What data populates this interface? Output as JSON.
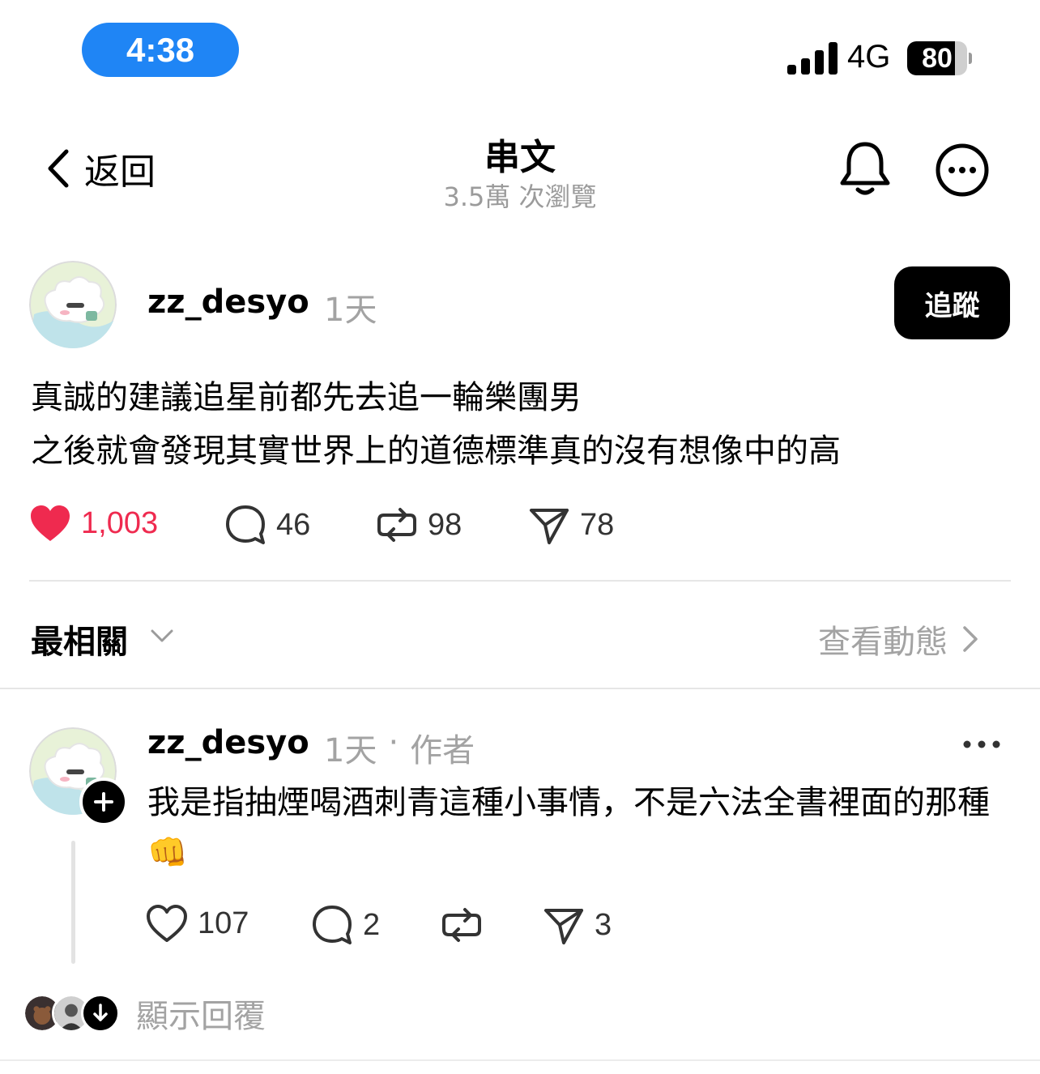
{
  "status_bar": {
    "time": "4:38",
    "network": "4G",
    "battery": "80",
    "battery_fraction": 0.8
  },
  "header": {
    "back_label": "返回",
    "title": "串文",
    "views": "3.5萬 次瀏覽"
  },
  "post": {
    "username": "zz_desyo",
    "time": "1天",
    "follow_label": "追蹤",
    "lines": [
      "真誠的建議追星前都先去追一輪樂團男",
      "之後就會發現其實世界上的道德標準真的沒有想像中的高"
    ],
    "likes": "1,003",
    "comments": "46",
    "reposts": "98",
    "shares": "78",
    "like_color": "#ef2a4f"
  },
  "sort": {
    "label": "最相關",
    "activity_label": "查看動態"
  },
  "reply": {
    "username": "zz_desyo",
    "time": "1天",
    "separator": "·",
    "role": "作者",
    "text": "我是指抽煙喝酒刺青這種小事情，不是六法全書裡面的那種👊",
    "likes": "107",
    "comments": "2",
    "reposts": "",
    "shares": "3"
  },
  "show_replies": {
    "label": "顯示回覆"
  },
  "colors": {
    "accent_blue": "#1f85f5",
    "muted_text": "#a3a3a3"
  }
}
